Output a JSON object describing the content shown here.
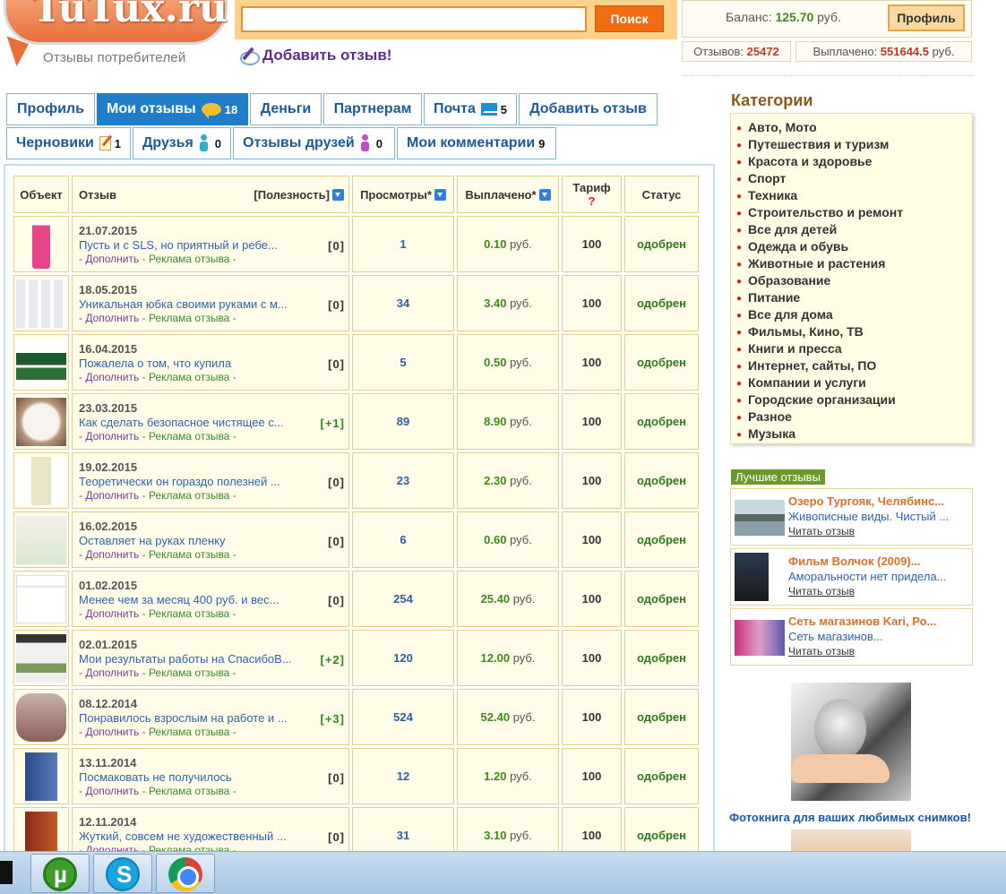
{
  "header": {
    "logo_text": "TuTux.ru",
    "logo_subtitle": "Отзывы потребителей",
    "search_button": "Поиск",
    "search_value": "",
    "add_review_link": "Добавить отзыв!",
    "balance_label": "Баланс:",
    "balance_value": "125.70",
    "balance_currency": "руб.",
    "profile_button": "Профиль",
    "reviews_count_label": "Отзывов:",
    "reviews_count_value": "25472",
    "paid_label": "Выплачено:",
    "paid_value": "551644.5",
    "paid_currency": "руб."
  },
  "tabs_row1": [
    {
      "label": "Профиль",
      "count": "",
      "icon": ""
    },
    {
      "label": "Мои отзывы",
      "count": "18",
      "icon": "speech-bubble-icon"
    },
    {
      "label": "Деньги",
      "count": "",
      "icon": ""
    },
    {
      "label": "Партнерам",
      "count": "",
      "icon": ""
    },
    {
      "label": "Почта",
      "count": "5",
      "icon": "mail-icon"
    },
    {
      "label": "Добавить отзыв",
      "count": "",
      "icon": ""
    }
  ],
  "tabs_row2": [
    {
      "label": "Черновики",
      "count": "1",
      "icon": "notepad-icon"
    },
    {
      "label": "Друзья",
      "count": "0",
      "icon": "people-icon"
    },
    {
      "label": "Отзывы друзей",
      "count": "0",
      "icon": "people-pink-icon"
    },
    {
      "label": "Мои комментарии",
      "count": "9",
      "icon": ""
    }
  ],
  "table": {
    "headers": {
      "object": "Объект",
      "review": "Отзыв",
      "usefulness": "[Полезность]",
      "views": "Просмотры*",
      "paid": "Выплачено*",
      "tariff": "Тариф",
      "tariff_help": "?",
      "status": "Статус"
    },
    "link_more": "- Дополнить",
    "link_ads": "- Реклама отзыва -",
    "currency": "руб.",
    "rows": [
      {
        "date": "21.07.2015",
        "title": "Пусть и с SLS, но приятный и ребе...",
        "useful": "[0]",
        "views": "1",
        "paid": "0.10",
        "tariff": "100",
        "status": "одобрен",
        "thumb": "pink"
      },
      {
        "date": "18.05.2015",
        "title": "Уникальная юбка своими руками с м...",
        "useful": "[0]",
        "views": "34",
        "paid": "3.40",
        "tariff": "100",
        "status": "одобрен",
        "thumb": "white"
      },
      {
        "date": "16.04.2015",
        "title": "Пожалела о том, что купила",
        "useful": "[0]",
        "views": "5",
        "paid": "0.50",
        "tariff": "100",
        "status": "одобрен",
        "thumb": "green"
      },
      {
        "date": "23.03.2015",
        "title": "Как сделать безопасное чистящее с...",
        "useful": "[+1]",
        "views": "89",
        "paid": "8.90",
        "tariff": "100",
        "status": "одобрен",
        "thumb": "cream"
      },
      {
        "date": "19.02.2015",
        "title": "Теоретически он гораздо полезней ...",
        "useful": "[0]",
        "views": "23",
        "paid": "2.30",
        "tariff": "100",
        "status": "одобрен",
        "thumb": "bottle"
      },
      {
        "date": "16.02.2015",
        "title": "Оставляет на руках пленку",
        "useful": "[0]",
        "views": "6",
        "paid": "0.60",
        "tariff": "100",
        "status": "одобрен",
        "thumb": "hand"
      },
      {
        "date": "01.02.2015",
        "title": "Менее чем за месяц 400 руб. и вес...",
        "useful": "[0]",
        "views": "254",
        "paid": "25.40",
        "tariff": "100",
        "status": "одобрен",
        "thumb": "screen1"
      },
      {
        "date": "02.01.2015",
        "title": "Мои результаты работы на СпасибоВ...",
        "useful": "[+2]",
        "views": "120",
        "paid": "12.00",
        "tariff": "100",
        "status": "одобрен",
        "thumb": "screen2"
      },
      {
        "date": "08.12.2014",
        "title": "Понравилось взрослым на работе и ...",
        "useful": "[+3]",
        "views": "524",
        "paid": "52.40",
        "tariff": "100",
        "status": "одобрен",
        "thumb": "cake"
      },
      {
        "date": "13.11.2014",
        "title": "Посмаковать не получилось",
        "useful": "[0]",
        "views": "12",
        "paid": "1.20",
        "tariff": "100",
        "status": "одобрен",
        "thumb": "book1"
      },
      {
        "date": "12.11.2014",
        "title": "Жуткий, совсем не художественный ...",
        "useful": "[0]",
        "views": "31",
        "paid": "3.10",
        "tariff": "100",
        "status": "одобрен",
        "thumb": "book2"
      }
    ]
  },
  "sidebar": {
    "categories_title": "Категории",
    "categories": [
      "Авто, Мото",
      "Путешествия и туризм",
      "Красота и здоровье",
      "Спорт",
      "Техника",
      "Строительство и ремонт",
      "Все для детей",
      "Одежда и обувь",
      "Животные и растения",
      "Образование",
      "Питание",
      "Все для дома",
      "Фильмы, Кино, ТВ",
      "Книги и пресса",
      "Интернет, сайты, ПО",
      "Компании и услуги",
      "Городские организации",
      "Разное",
      "Музыка"
    ],
    "best_label": "Лучшие отзывы",
    "best": [
      {
        "title": "Озеро Тургояк, Челябинс...",
        "text": "Живописные виды. Чистый ...",
        "link": "Читать отзыв"
      },
      {
        "title": "Фильм Волчок (2009)...",
        "text": "Аморальности нет придела...",
        "link": "Читать отзыв"
      },
      {
        "title": "Сеть магазинов Kari, Ро...",
        "text": "Сеть магазинов...",
        "link": "Читать отзыв"
      }
    ],
    "promo_text": "Фотокнига для ваших любимых снимков!"
  },
  "taskbar": {
    "apps": [
      "utorrent-icon",
      "skype-icon",
      "chrome-icon"
    ]
  },
  "colors": {
    "tab_active": "#1f7ec7",
    "search_button": "#f26d12",
    "status_ok": "#2e7a1a",
    "category_bullet": "#d2231b"
  }
}
